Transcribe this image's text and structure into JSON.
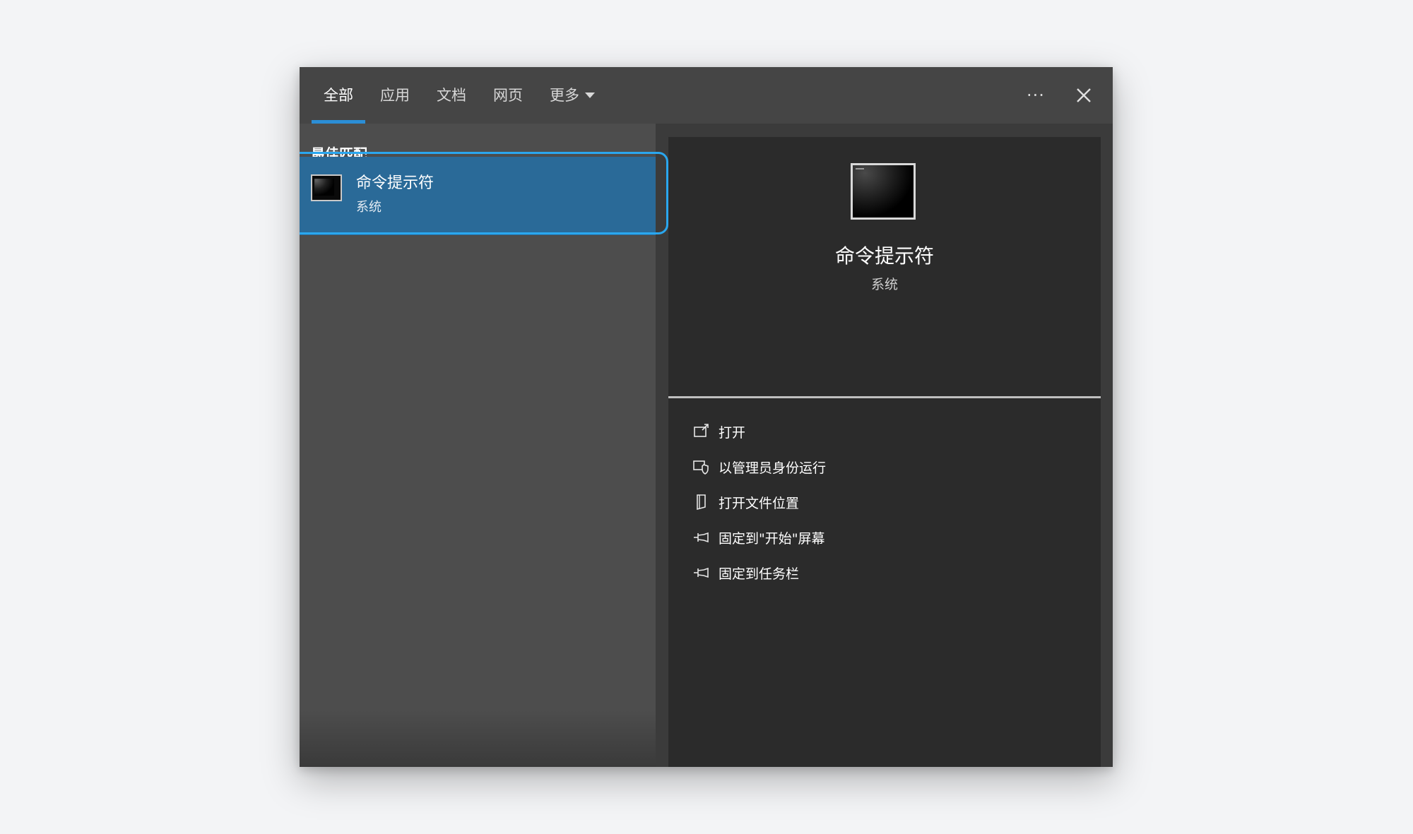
{
  "tabs": [
    {
      "label": "全部"
    },
    {
      "label": "应用"
    },
    {
      "label": "文档"
    },
    {
      "label": "网页"
    },
    {
      "label": "更多"
    }
  ],
  "toolbar": {
    "more_dots": "···"
  },
  "left": {
    "section_title": "最佳匹配",
    "best_match": {
      "title": "命令提示符",
      "subtitle": "系统",
      "icon": "command-prompt-icon"
    }
  },
  "right": {
    "app_title": "命令提示符",
    "app_subtitle": "系统",
    "icon": "command-prompt-icon",
    "actions": [
      {
        "label": "打开",
        "icon": "open-icon"
      },
      {
        "label": "以管理员身份运行",
        "icon": "shield-icon"
      },
      {
        "label": "打开文件位置",
        "icon": "file-location-icon"
      },
      {
        "label": "固定到\"开始\"屏幕",
        "icon": "pin-icon"
      },
      {
        "label": "固定到任务栏",
        "icon": "pin-icon"
      }
    ]
  },
  "colors": {
    "accent": "#2b8ed6",
    "highlight": "#2a6a98",
    "outline": "#2aa7ef"
  }
}
